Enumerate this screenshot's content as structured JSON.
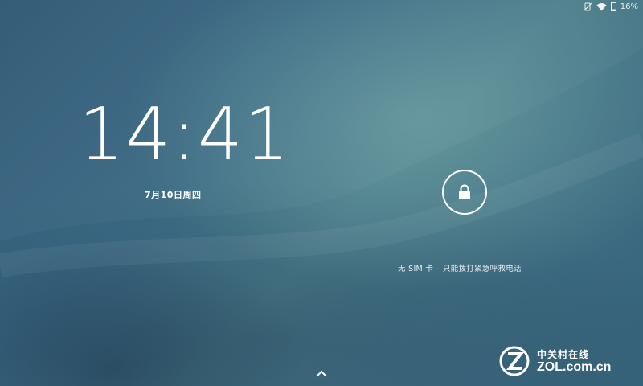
{
  "status_bar": {
    "icons": [
      "no-sim-icon",
      "wifi-icon",
      "battery-icon"
    ],
    "battery_percent": "16%"
  },
  "lockscreen": {
    "time": "14:41",
    "date": "7月10日周四",
    "unlock_icon": "lock-icon",
    "sim_message": "无 SIM 卡 – 只能拨打紧急呼救电话",
    "swipe_up_icon": "chevron-up-icon"
  },
  "watermark": {
    "chinese": "中关村在线",
    "url": "ZOL.com.cn"
  },
  "colors": {
    "background_dark": "#2f5774",
    "background_light": "#4a7c8a",
    "foreground": "#ffffff"
  }
}
